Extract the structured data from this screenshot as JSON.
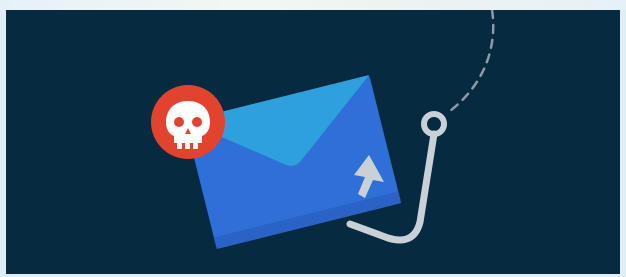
{
  "illustration": {
    "subject": "",
    "colors": {
      "background": "#062a3f",
      "border": "#dfeef4",
      "envelope_body": "#2f6fd8",
      "envelope_flap": "#2ea0dc",
      "skull_badge": "#e2432f",
      "skull": "#ffffff",
      "hook": "#c9d1d8",
      "fishing_line": "#8c9aa4"
    },
    "icons": [
      "envelope-icon",
      "skull-icon",
      "fishing-hook-icon",
      "cursor-arrow-icon"
    ]
  }
}
